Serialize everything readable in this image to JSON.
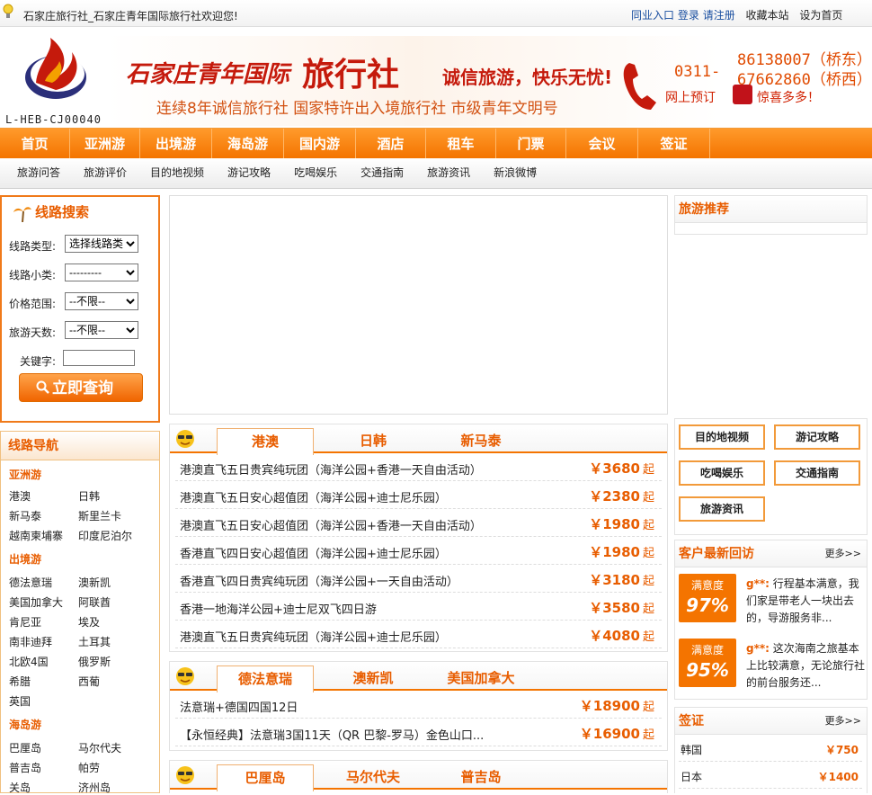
{
  "topbar": {
    "welcome": "石家庄旅行社_石家庄青年国际旅行社欢迎您!",
    "links": [
      "同业入口",
      "登录",
      "请注册",
      "收藏本站",
      "设为首页"
    ]
  },
  "logo": {
    "code": "L-HEB-CJ00040"
  },
  "banner": {
    "slogan1": "石家庄青年国际",
    "slogan2": "旅行社",
    "slogan3": "诚信旅游，快乐无忧!",
    "slogan4": "连续8年诚信旅行社 国家特许出入境旅行社 市级青年文明号",
    "area_code": "0311-",
    "tel_east": "86138007（桥东）",
    "tel_west": "67662860（桥西）",
    "book": "网上预订",
    "gift": "惊喜多多！"
  },
  "nav": {
    "items": [
      "首页",
      "亚洲游",
      "出境游",
      "海岛游",
      "国内游",
      "酒店",
      "租车",
      "门票",
      "会议",
      "签证"
    ]
  },
  "subnav": {
    "items": [
      "旅游问答",
      "旅游评价",
      "目的地视频",
      "游记攻略",
      "吃喝娱乐",
      "交通指南",
      "旅游资讯",
      "新浪微博"
    ]
  },
  "search": {
    "title": "线路搜索",
    "type_label": "线路类型:",
    "type_value": "选择线路类",
    "sub_label": "线路小类:",
    "sub_value": "---------",
    "price_label": "价格范围:",
    "price_value": "--不限--",
    "days_label": "旅游天数:",
    "days_value": "--不限--",
    "kw_label": "关键字:",
    "button": "立即查询"
  },
  "routes": {
    "title": "线路导航",
    "sections": [
      {
        "name": "亚洲游",
        "items": [
          "港澳",
          "日韩",
          "新马泰",
          "斯里兰卡",
          "越南柬埔寨",
          "印度尼泊尔"
        ]
      },
      {
        "name": "出境游",
        "items": [
          "德法意瑞",
          "澳新凯",
          "美国加拿大",
          "阿联酋",
          "肯尼亚",
          "埃及",
          "南非迪拜",
          "土耳其",
          "北欧4国",
          "俄罗斯",
          "希腊",
          "西葡",
          "英国"
        ]
      },
      {
        "name": "海岛游",
        "items": [
          "巴厘岛",
          "马尔代夫",
          "普吉岛",
          "帕劳",
          "关岛",
          "济州岛"
        ]
      }
    ]
  },
  "box1": {
    "tabs": [
      "港澳",
      "日韩",
      "新马泰"
    ],
    "rows": [
      {
        "name": "港澳直飞五日贵宾纯玩团（海洋公园+香港一天自由活动）",
        "price": "￥3680"
      },
      {
        "name": "港澳直飞五日安心超值团（海洋公园+迪士尼乐园）",
        "price": "￥2380"
      },
      {
        "name": "港澳直飞五日安心超值团（海洋公园+香港一天自由活动）",
        "price": "￥1980"
      },
      {
        "name": "香港直飞四日安心超值团（海洋公园+迪士尼乐园）",
        "price": "￥1980"
      },
      {
        "name": "香港直飞四日贵宾纯玩团（海洋公园+一天自由活动）",
        "price": "￥3180"
      },
      {
        "name": "香港一地海洋公园+迪士尼双飞四日游",
        "price": "￥3580"
      },
      {
        "name": "港澳直飞五日贵宾纯玩团（海洋公园+迪士尼乐园）",
        "price": "￥4080"
      }
    ],
    "suffix": "起"
  },
  "box2": {
    "tabs": [
      "德法意瑞",
      "澳新凯",
      "美国加拿大"
    ],
    "rows": [
      {
        "name": "法意瑞+德国四国12日",
        "price": "￥18900"
      },
      {
        "name": "【永恒经典】法意瑞3国11天（QR 巴黎-罗马）金色山口...",
        "price": "￥16900"
      }
    ],
    "suffix": "起"
  },
  "box3": {
    "tabs": [
      "巴厘岛",
      "马尔代夫",
      "普吉岛"
    ]
  },
  "right": {
    "recommend_title": "旅游推荐",
    "quick": [
      "目的地视频",
      "游记攻略",
      "吃喝娱乐",
      "交通指南",
      "旅游资讯"
    ],
    "reviews_title": "客户最新回访",
    "more": "更多>>",
    "reviews": [
      {
        "label": "满意度",
        "value": "97%",
        "user": "g**:",
        "text": "行程基本满意，我们家是带老人一块出去的，导游服务非..."
      },
      {
        "label": "满意度",
        "value": "95%",
        "user": "g**:",
        "text": "这次海南之旅基本上比较满意，无论旅行社的前台服务还..."
      }
    ],
    "visa_title": "签证",
    "visa": [
      {
        "country": "韩国",
        "price": "￥750"
      },
      {
        "country": "日本",
        "price": "￥1400"
      }
    ]
  },
  "colors": {
    "accent": "#f47400",
    "brand_red": "#c51a0c",
    "link_blue": "#1a4fa0"
  }
}
